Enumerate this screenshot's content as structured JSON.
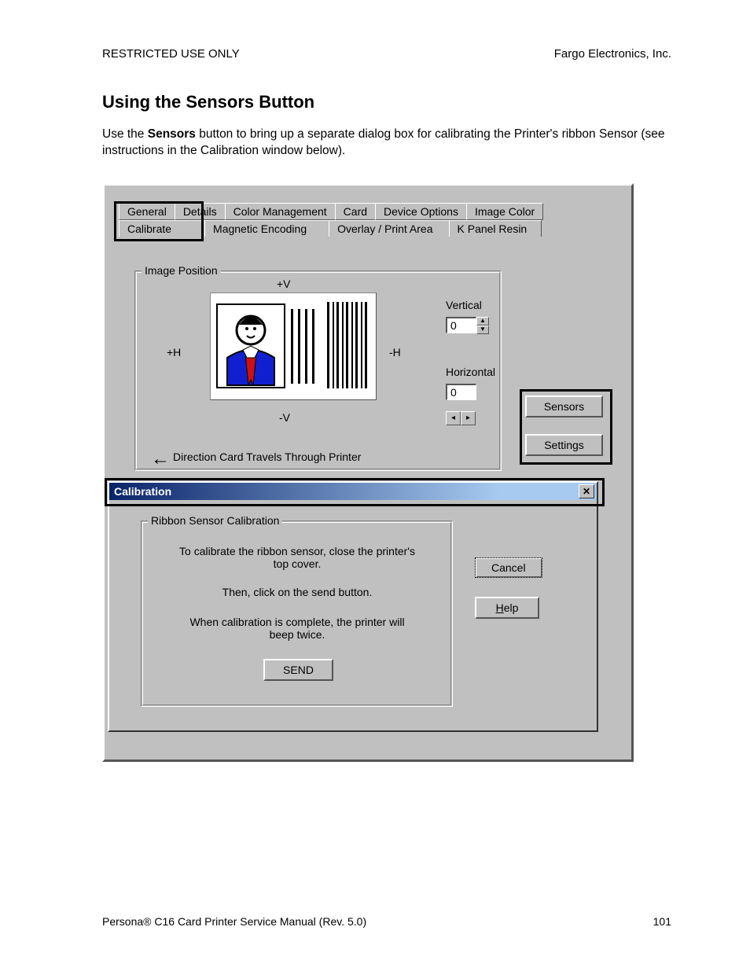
{
  "header": {
    "left": "RESTRICTED USE ONLY",
    "right": "Fargo Electronics, Inc."
  },
  "title": "Using the Sensors Button",
  "body": {
    "pre": "Use the ",
    "bold": "Sensors",
    "post": " button to bring up a separate dialog box for calibrating the Printer's ribbon Sensor (see instructions in the Calibration window below)."
  },
  "tabs_row1": [
    "General",
    "Details",
    "Color Management",
    "Card",
    "Device Options",
    "Image Color"
  ],
  "tabs_row2": [
    "Calibrate",
    "Magnetic Encoding",
    "Overlay / Print Area",
    "K Panel Resin"
  ],
  "imgpos": {
    "legend": "Image Position",
    "plusV": "+V",
    "minusV": "-V",
    "plusH": "+H",
    "minusH": "-H",
    "direction": "Direction Card Travels Through Printer",
    "vertical_label": "Vertical",
    "horizontal_label": "Horizontal",
    "vertical_value": "0",
    "horizontal_value": "0"
  },
  "buttons": {
    "sensors": "Sensors",
    "settings": "Settings"
  },
  "calibration": {
    "title": "Calibration",
    "group_legend": "Ribbon Sensor Calibration",
    "line1": "To calibrate the ribbon sensor, close the printer's top cover.",
    "line2": "Then, click on the send button.",
    "line3": "When calibration is complete, the printer will beep twice.",
    "send": "SEND",
    "cancel": "Cancel",
    "help_pre": "H",
    "help_post": "elp"
  },
  "footer": {
    "left_pre": "Persona",
    "left_sym": "®",
    "left_post": " C16 Card Printer Service Manual (Rev. 5.0)",
    "page": "101"
  }
}
